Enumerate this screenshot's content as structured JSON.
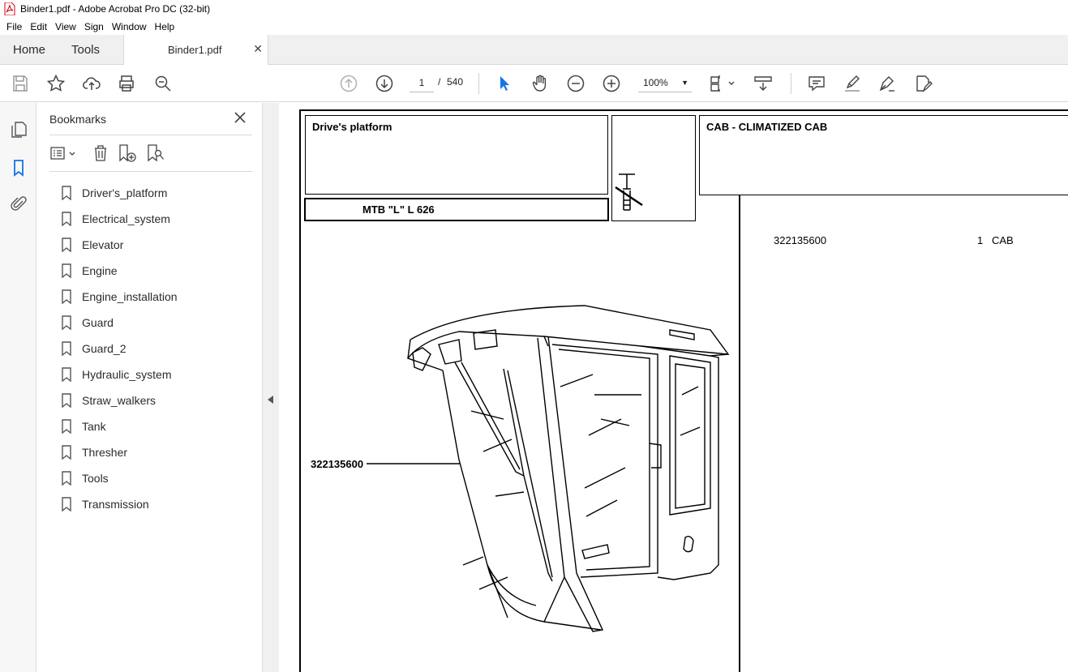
{
  "window": {
    "title": "Binder1.pdf - Adobe Acrobat Pro DC (32-bit)"
  },
  "menu": [
    "File",
    "Edit",
    "View",
    "Sign",
    "Window",
    "Help"
  ],
  "tabs": {
    "home": "Home",
    "tools": "Tools",
    "document": "Binder1.pdf"
  },
  "toolbar": {
    "current_page": "1",
    "page_separator": "/",
    "total_pages": "540",
    "zoom": "100%"
  },
  "bookmarks_panel": {
    "title": "Bookmarks",
    "items": [
      "Driver's_platform",
      "Electrical_system",
      "Elevator",
      "Engine",
      "Engine_installation",
      "Guard",
      "Guard_2",
      "Hydraulic_system",
      "Straw_walkers",
      "Tank",
      "Thresher",
      "Tools",
      "Transmission"
    ]
  },
  "document": {
    "header_left": "Drive's platform",
    "model": "MTB \"L\" L 626",
    "header_right": "CAB - CLIMATIZED CAB",
    "callout_part": "322135600",
    "parts_list": [
      {
        "number": "322135600",
        "qty": "1",
        "desc": "CAB"
      }
    ]
  },
  "colors": {
    "accent_blue": "#1473e6",
    "acrobat_red": "#d3000a"
  }
}
